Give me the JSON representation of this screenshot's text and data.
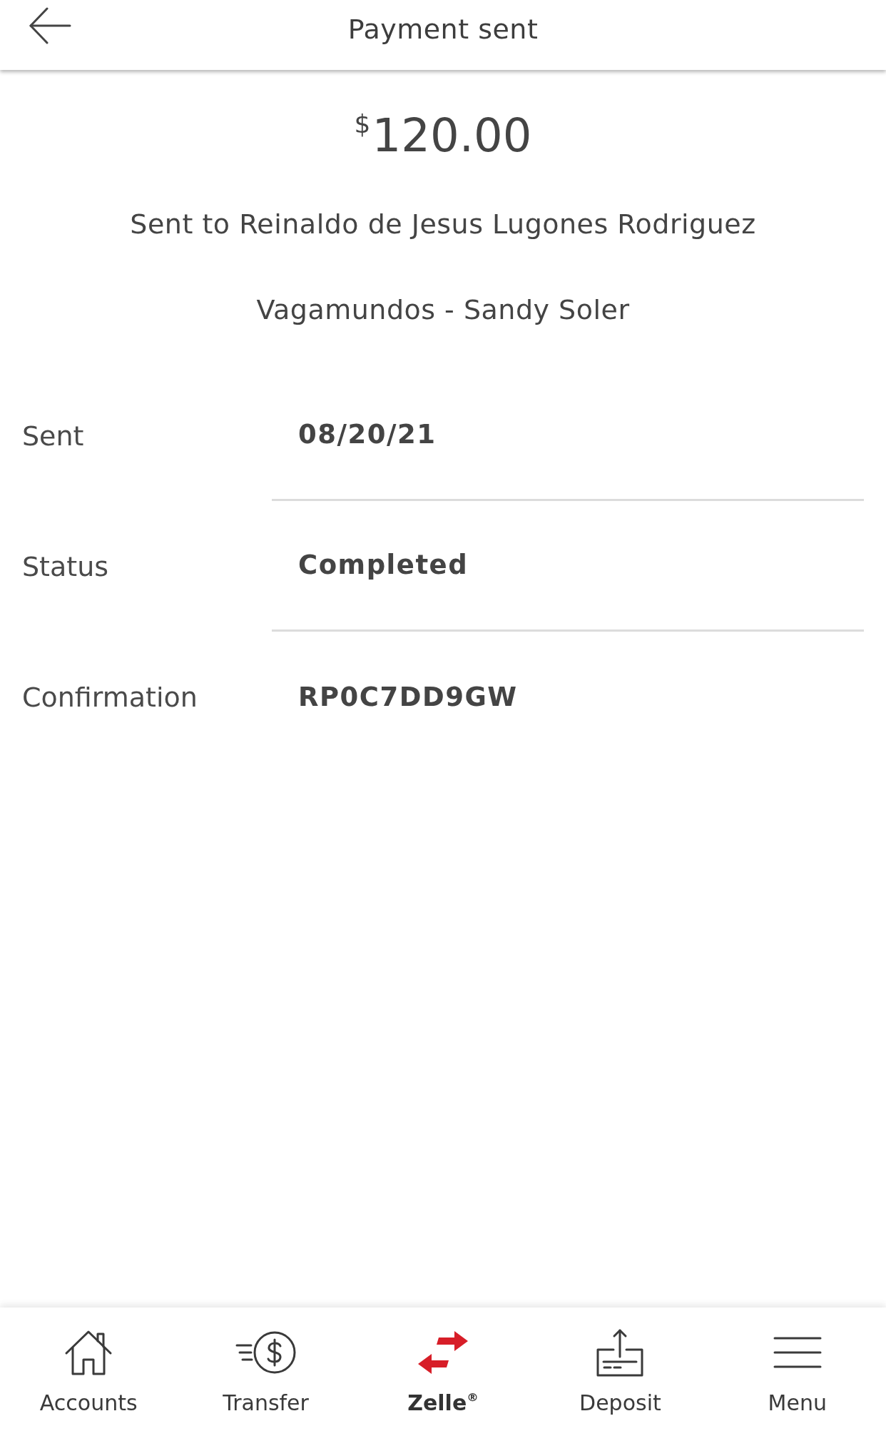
{
  "header": {
    "title": "Payment sent"
  },
  "payment": {
    "currency_symbol": "$",
    "amount": "120.00",
    "recipient_line": "Sent to Reinaldo de Jesus Lugones Rodriguez",
    "memo": "Vagamundos - Sandy Soler"
  },
  "details": [
    {
      "label": "Sent",
      "value": "08/20/21"
    },
    {
      "label": "Status",
      "value": "Completed"
    },
    {
      "label": "Confirmation",
      "value": "RP0C7DD9GW"
    }
  ],
  "bottom_nav": [
    {
      "kind": "house",
      "label": "Accounts",
      "selected": false
    },
    {
      "kind": "transfer",
      "label": "Transfer",
      "selected": false
    },
    {
      "kind": "zelle",
      "label": "Zelle$^{®}$",
      "selected": true
    },
    {
      "kind": "deposit",
      "label": "Deposit",
      "selected": false
    },
    {
      "kind": "menu",
      "label": "Menu",
      "selected": false
    }
  ]
}
